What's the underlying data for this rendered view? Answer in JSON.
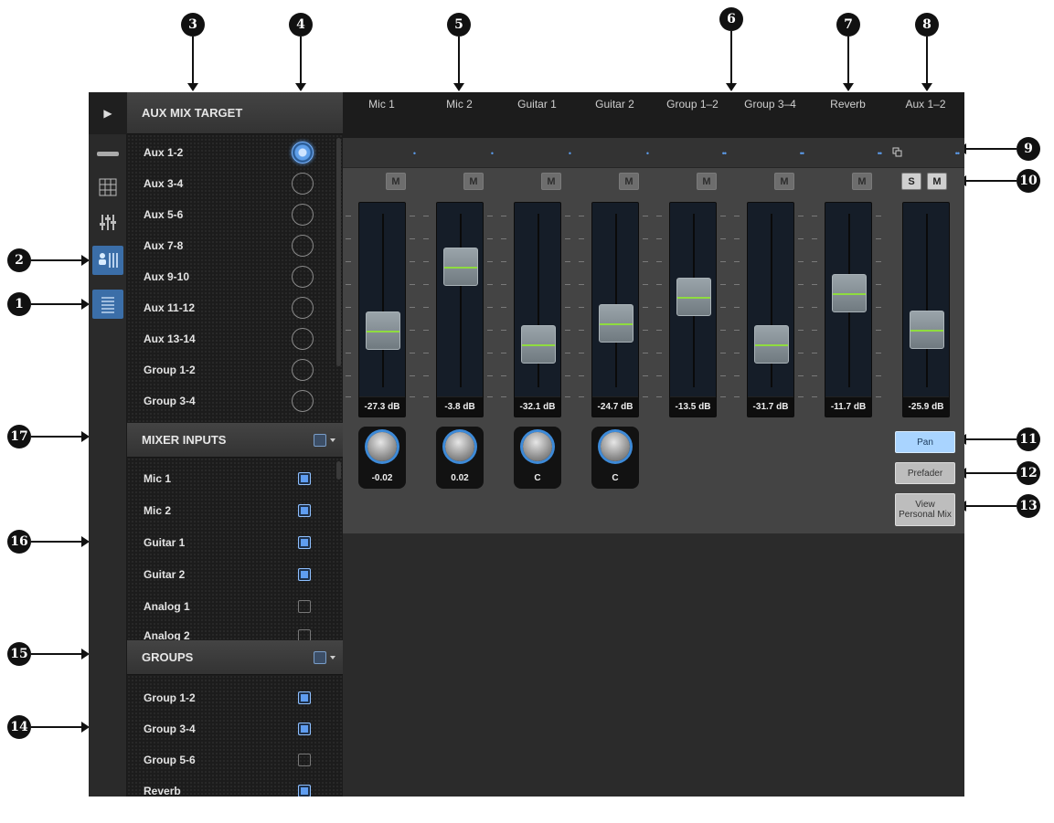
{
  "callouts": [
    "1",
    "2",
    "3",
    "4",
    "5",
    "6",
    "7",
    "8",
    "9",
    "10",
    "11",
    "12",
    "13",
    "14",
    "15",
    "16",
    "17"
  ],
  "icon_bar": {
    "expand": "▶",
    "icons": [
      "strip-icon",
      "grid-icon",
      "faders-icon",
      "aux-mix-icon",
      "list-icon"
    ],
    "active_icon": "list-icon"
  },
  "aux_mix_target": {
    "title": "AUX MIX TARGET",
    "items": [
      {
        "label": "Aux 1-2",
        "selected": true
      },
      {
        "label": "Aux 3-4",
        "selected": false
      },
      {
        "label": "Aux 5-6",
        "selected": false
      },
      {
        "label": "Aux 7-8",
        "selected": false
      },
      {
        "label": "Aux 9-10",
        "selected": false
      },
      {
        "label": "Aux 11-12",
        "selected": false
      },
      {
        "label": "Aux 13-14",
        "selected": false
      },
      {
        "label": "Group 1-2",
        "selected": false
      },
      {
        "label": "Group 3-4",
        "selected": false
      }
    ]
  },
  "mixer_inputs": {
    "title": "MIXER INPUTS",
    "items": [
      {
        "label": "Mic 1",
        "checked": true
      },
      {
        "label": "Mic 2",
        "checked": true
      },
      {
        "label": "Guitar 1",
        "checked": true
      },
      {
        "label": "Guitar 2",
        "checked": true
      },
      {
        "label": "Analog 1",
        "checked": false
      },
      {
        "label": "Analog 2",
        "checked": false
      }
    ]
  },
  "groups": {
    "title": "GROUPS",
    "items": [
      {
        "label": "Group 1-2",
        "checked": true
      },
      {
        "label": "Group 3-4",
        "checked": true
      },
      {
        "label": "Group 5-6",
        "checked": false
      },
      {
        "label": "Reverb",
        "checked": true
      }
    ]
  },
  "channels": [
    {
      "name": "Mic 1",
      "mute": "M",
      "level_db": "-27.3 dB",
      "fader_fraction": 0.33,
      "pan": "-0.02",
      "link": "•"
    },
    {
      "name": "Mic 2",
      "mute": "M",
      "level_db": "-3.8 dB",
      "fader_fraction": 0.77,
      "pan": "0.02",
      "link": "•"
    },
    {
      "name": "Guitar 1",
      "mute": "M",
      "level_db": "-32.1 dB",
      "fader_fraction": 0.24,
      "pan": "C",
      "link": "•"
    },
    {
      "name": "Guitar 2",
      "mute": "M",
      "level_db": "-24.7 dB",
      "fader_fraction": 0.38,
      "pan": "C",
      "link": "•"
    },
    {
      "name": "Group 1–2",
      "mute": "M",
      "level_db": "-13.5 dB",
      "fader_fraction": 0.56,
      "link": "••"
    },
    {
      "name": "Group 3–4",
      "mute": "M",
      "level_db": "-31.7 dB",
      "fader_fraction": 0.24,
      "link": "••"
    },
    {
      "name": "Reverb",
      "mute": "M",
      "level_db": "-11.7 dB",
      "fader_fraction": 0.59,
      "link": "••"
    }
  ],
  "aux_master": {
    "name": "Aux 1–2",
    "solo": "S",
    "mute": "M",
    "level_db": "-25.9 dB",
    "fader_fraction": 0.34,
    "link": "••",
    "pan_button": "Pan",
    "prefader_button": "Prefader",
    "view_button_line1": "View",
    "view_button_line2": "Personal Mix"
  },
  "colors": {
    "accent": "#5f9df0",
    "active_icon_bg": "#3b6ea8",
    "fader_line": "#8fdc3f"
  }
}
